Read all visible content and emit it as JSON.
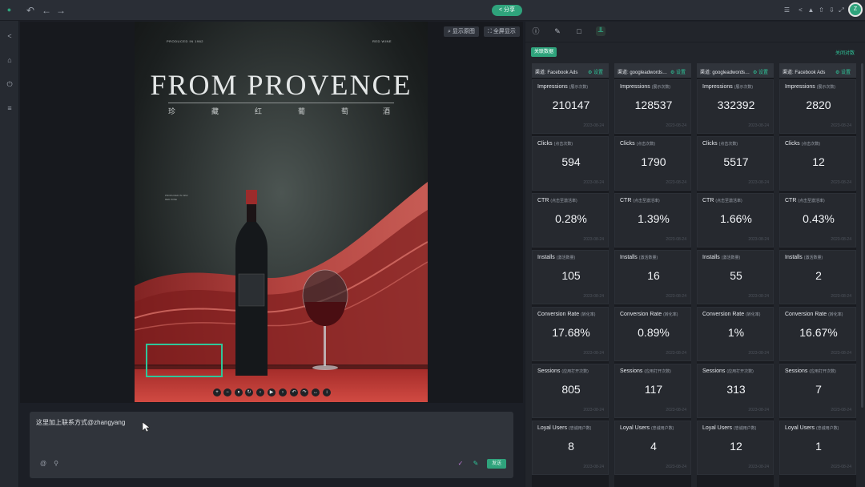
{
  "toolbar": {
    "undo_icon": "undo-icon",
    "back_icon": "arrow-left-icon",
    "forward_icon": "arrow-right-icon",
    "share_label": "分享",
    "right_icons": [
      "menu-icon",
      "share-icon",
      "bell-icon",
      "upload-icon",
      "download-icon",
      "fullscreen-icon"
    ],
    "avatar_initial": "Z",
    "accent_color": "#2fa37c"
  },
  "rail": {
    "icons": [
      "back-icon",
      "home-icon",
      "plugin-icon",
      "layers-icon"
    ]
  },
  "canvas": {
    "show_original": "显示原图",
    "fullscreen": "全屏显示",
    "poster": {
      "produced_in": "PRODUCED IN 1962",
      "red_wine": "RED WINE",
      "title": "FROM PROVENCE",
      "subtitle_chars": [
        "珍",
        "藏",
        "红",
        "葡",
        "萄",
        "酒"
      ],
      "note_line1": "PRODUCED IN 1962",
      "note_line2": "RED WINE"
    },
    "controls": [
      "+",
      "−",
      "⏸",
      "↻",
      "‹",
      "▶",
      "›",
      "↶",
      "↷",
      "↔",
      "↕"
    ]
  },
  "chat": {
    "text": "这里加上联系方式@zhangyang",
    "send_label": "发送"
  },
  "panel": {
    "tabs": [
      "info-icon",
      "image-edit-icon",
      "box-icon",
      "chart-icon"
    ],
    "associate_label": "关联数据",
    "close_label": "关闭对数",
    "settings_label": "设置",
    "columns": [
      {
        "channel": "渠道: Facebook Ads",
        "metrics": [
          {
            "label": "Impressions",
            "sub": "(展示次数)",
            "value": "210147",
            "date": "2023-08-24"
          },
          {
            "label": "Clicks",
            "sub": "(点击次数)",
            "value": "594",
            "date": "2023-08-24"
          },
          {
            "label": "CTR",
            "sub": "(点击至激活率)",
            "value": "0.28%",
            "date": "2023-08-24"
          },
          {
            "label": "Installs",
            "sub": "(激活数量)",
            "value": "105",
            "date": "2023-08-24"
          },
          {
            "label": "Conversion Rate",
            "sub": "(转化率)",
            "value": "17.68%",
            "date": "2023-08-24"
          },
          {
            "label": "Sessions",
            "sub": "(应用打开次数)",
            "value": "805",
            "date": "2023-08-24"
          },
          {
            "label": "Loyal Users",
            "sub": "(忠诚用户数)",
            "value": "8",
            "date": "2023-08-24"
          }
        ]
      },
      {
        "channel": "渠道: googleadwords_int",
        "metrics": [
          {
            "label": "Impressions",
            "sub": "(展示次数)",
            "value": "128537",
            "date": "2023-08-24"
          },
          {
            "label": "Clicks",
            "sub": "(点击次数)",
            "value": "1790",
            "date": "2023-08-24"
          },
          {
            "label": "CTR",
            "sub": "(点击至激活率)",
            "value": "1.39%",
            "date": "2023-08-24"
          },
          {
            "label": "Installs",
            "sub": "(激活数量)",
            "value": "16",
            "date": "2023-08-24"
          },
          {
            "label": "Conversion Rate",
            "sub": "(转化率)",
            "value": "0.89%",
            "date": "2023-08-24"
          },
          {
            "label": "Sessions",
            "sub": "(应用打开次数)",
            "value": "117",
            "date": "2023-08-24"
          },
          {
            "label": "Loyal Users",
            "sub": "(忠诚用户数)",
            "value": "4",
            "date": "2023-08-24"
          }
        ]
      },
      {
        "channel": "渠道: googleadwords_int",
        "metrics": [
          {
            "label": "Impressions",
            "sub": "(展示次数)",
            "value": "332392",
            "date": "2023-08-24"
          },
          {
            "label": "Clicks",
            "sub": "(点击次数)",
            "value": "5517",
            "date": "2023-08-24"
          },
          {
            "label": "CTR",
            "sub": "(点击至激活率)",
            "value": "1.66%",
            "date": "2023-08-24"
          },
          {
            "label": "Installs",
            "sub": "(激活数量)",
            "value": "55",
            "date": "2023-08-24"
          },
          {
            "label": "Conversion Rate",
            "sub": "(转化率)",
            "value": "1%",
            "date": "2023-08-24"
          },
          {
            "label": "Sessions",
            "sub": "(应用打开次数)",
            "value": "313",
            "date": "2023-08-24"
          },
          {
            "label": "Loyal Users",
            "sub": "(忠诚用户数)",
            "value": "12",
            "date": "2023-08-24"
          }
        ]
      },
      {
        "channel": "渠道: Facebook Ads",
        "metrics": [
          {
            "label": "Impressions",
            "sub": "(展示次数)",
            "value": "2820",
            "date": "2023-08-24"
          },
          {
            "label": "Clicks",
            "sub": "(点击次数)",
            "value": "12",
            "date": "2023-08-24"
          },
          {
            "label": "CTR",
            "sub": "(点击至激活率)",
            "value": "0.43%",
            "date": "2023-08-24"
          },
          {
            "label": "Installs",
            "sub": "(激活数量)",
            "value": "2",
            "date": "2023-08-24"
          },
          {
            "label": "Conversion Rate",
            "sub": "(转化率)",
            "value": "16.67%",
            "date": "2023-08-24"
          },
          {
            "label": "Sessions",
            "sub": "(应用打开次数)",
            "value": "7",
            "date": "2023-08-24"
          },
          {
            "label": "Loyal Users",
            "sub": "(忠诚用户数)",
            "value": "1",
            "date": "2023-08-24"
          }
        ]
      }
    ]
  }
}
